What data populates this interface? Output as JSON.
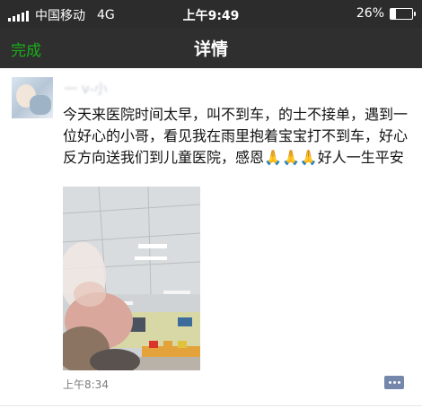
{
  "status_bar": {
    "carrier": "中国移动",
    "network": "4G",
    "time": "上午9:49",
    "battery_text": "26%",
    "battery_level": 0.26
  },
  "nav": {
    "done_label": "完成",
    "title": "详情"
  },
  "post": {
    "poster_name": "一 v-小",
    "text": "今天来医院时间太早，叫不到车，的士不接单，遇到一位好心的小哥，看见我在雨里抱着宝宝打不到车，好心反方向送我们到儿童医院，感恩",
    "text_end": "好人一生平安",
    "prayer_emoji": "🙏",
    "timestamp": "上午8:34"
  },
  "icons": {
    "signal": "signal-bars-icon",
    "battery": "battery-icon",
    "comment": "comment-more-icon"
  },
  "colors": {
    "status_bg": "#2c2c2c",
    "nav_bg": "#2f2f2f",
    "done_green": "#1aad19",
    "comment_btn": "#7587ab"
  }
}
